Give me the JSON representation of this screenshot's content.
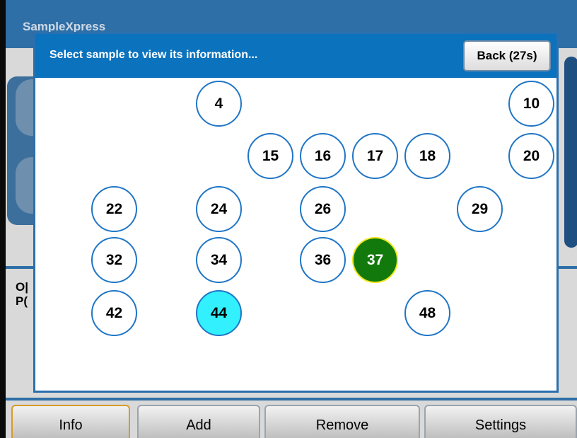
{
  "app": {
    "title": "SampleXpress",
    "bg_text_1": "O|",
    "bg_text_2": "P("
  },
  "dialog": {
    "title": "Select sample to view its information...",
    "back_label": "Back (27s)"
  },
  "samples": [
    {
      "label": "4",
      "state": "normal"
    },
    {
      "label": "10",
      "state": "normal"
    },
    {
      "label": "15",
      "state": "normal"
    },
    {
      "label": "16",
      "state": "normal"
    },
    {
      "label": "17",
      "state": "normal"
    },
    {
      "label": "18",
      "state": "normal"
    },
    {
      "label": "20",
      "state": "normal"
    },
    {
      "label": "22",
      "state": "normal"
    },
    {
      "label": "24",
      "state": "normal"
    },
    {
      "label": "26",
      "state": "normal"
    },
    {
      "label": "29",
      "state": "normal"
    },
    {
      "label": "32",
      "state": "normal"
    },
    {
      "label": "34",
      "state": "normal"
    },
    {
      "label": "36",
      "state": "normal"
    },
    {
      "label": "37",
      "state": "selected-green"
    },
    {
      "label": "42",
      "state": "normal"
    },
    {
      "label": "44",
      "state": "selected-cyan"
    },
    {
      "label": "48",
      "state": "normal"
    }
  ],
  "tabs": [
    {
      "label": "Info",
      "active": true
    },
    {
      "label": "Add",
      "active": false
    },
    {
      "label": "Remove",
      "active": false
    },
    {
      "label": "Settings",
      "active": false
    }
  ],
  "colors": {
    "header": "#2f6fa7",
    "dialog_header": "#0b72bd",
    "ring": "#1f75c6",
    "selected_cyan": "#33f0ff",
    "selected_green": "#127a0c",
    "active_tab_border": "#d79a2b"
  }
}
